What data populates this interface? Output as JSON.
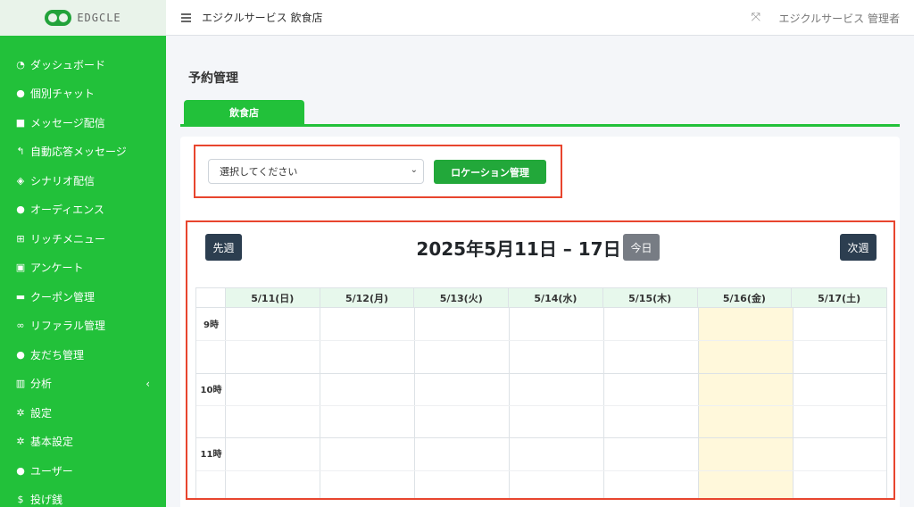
{
  "brand": {
    "name": "EDGCLE"
  },
  "header": {
    "store_title": "エジクルサービス 飲食店",
    "admin_name": "エジクルサービス 管理者"
  },
  "sidebar": {
    "items": [
      {
        "label": "ダッシュボード",
        "icon": "dashboard-icon"
      },
      {
        "label": "個別チャット",
        "icon": "chat-icon"
      },
      {
        "label": "メッセージ配信",
        "icon": "message-icon"
      },
      {
        "label": "自動応答メッセージ",
        "icon": "reply-icon"
      },
      {
        "label": "シナリオ配信",
        "icon": "layers-icon"
      },
      {
        "label": "オーディエンス",
        "icon": "users-icon"
      },
      {
        "label": "リッチメニュー",
        "icon": "grid-icon"
      },
      {
        "label": "アンケート",
        "icon": "survey-icon"
      },
      {
        "label": "クーポン管理",
        "icon": "coupon-icon"
      },
      {
        "label": "リファラル管理",
        "icon": "link-icon"
      },
      {
        "label": "友だち管理",
        "icon": "friends-icon"
      },
      {
        "label": "分析",
        "icon": "chart-icon"
      },
      {
        "label": "設定",
        "icon": "gear-icon"
      },
      {
        "label": "基本設定",
        "icon": "gear-icon"
      },
      {
        "label": "ユーザー",
        "icon": "user-icon"
      },
      {
        "label": "投げ銭",
        "icon": "dollar-icon"
      }
    ]
  },
  "main": {
    "page_title": "予約管理",
    "tab_label": "飲食店",
    "select_value": "選択してください",
    "location_button": "ロケーション管理"
  },
  "calendar": {
    "title": "2025年5月11日 – 17日",
    "prev_label": "先週",
    "next_label": "次週",
    "today_label": "今日",
    "days": [
      "5/11(日)",
      "5/12(月)",
      "5/13(火)",
      "5/14(水)",
      "5/15(木)",
      "5/16(金)",
      "5/17(土)"
    ],
    "today_index": 5,
    "hours": [
      "9時",
      "10時",
      "11時"
    ]
  },
  "colors": {
    "sidebar": "#22c13a",
    "highlight_border": "#e8452e",
    "today_column": "#fff8db",
    "header_row": "#e7f8ec",
    "dark_button": "#2c3e50"
  }
}
